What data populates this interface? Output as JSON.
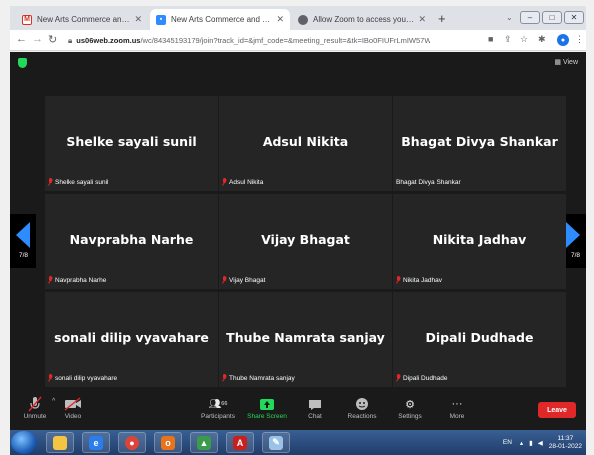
{
  "browser": {
    "tabs": [
      {
        "title": "New Arts Commerce and Scienc",
        "favicon": "gmail-icon",
        "active": false
      },
      {
        "title": "New Arts Commerce and Scienc",
        "favicon": "zoom-icon",
        "active": true
      },
      {
        "title": "Allow Zoom to access your came",
        "favicon": "chrome-icon",
        "active": false
      }
    ],
    "new_tab": "+",
    "url_host": "us06web.zoom.us",
    "url_path": "/wc/84345193179/join?track_id=&jmf_code=&meeting_result=&tk=IBo0FIUFrLmIW57W..."
  },
  "meeting": {
    "view_label": "View",
    "page_indicator": "7/8",
    "participants": [
      {
        "display": "Shelke sayali sunil",
        "label": "Shelke sayali sunil",
        "muted": true
      },
      {
        "display": "Adsul Nikita",
        "label": "Adsul Nikita",
        "muted": true
      },
      {
        "display": "Bhagat Divya Shankar",
        "label": "Bhagat Divya Shankar",
        "muted": false
      },
      {
        "display": "Navprabha Narhe",
        "label": "Navprabha Narhe",
        "muted": true
      },
      {
        "display": "Vijay Bhagat",
        "label": "Vijay Bhagat",
        "muted": true
      },
      {
        "display": "Nikita Jadhav",
        "label": "Nikita Jadhav",
        "muted": true
      },
      {
        "display": "sonali dilip vyavahare",
        "label": "sonali dilip vyavahare",
        "muted": true
      },
      {
        "display": "Thube Namrata sanjay",
        "label": "Thube Namrata sanjay",
        "muted": true
      },
      {
        "display": "Dipali Dudhade",
        "label": "Dipali Dudhade",
        "muted": true
      }
    ]
  },
  "toolbar": {
    "unmute": "Unmute",
    "video": "Video",
    "participants": "Participants",
    "participants_count": "66",
    "share": "Share Screen",
    "chat": "Chat",
    "reactions": "Reactions",
    "settings": "Settings",
    "more": "More",
    "leave": "Leave"
  },
  "taskbar": {
    "lang": "EN",
    "time": "11:37",
    "date": "28-01-2022"
  },
  "colors": {
    "zoom_bg": "#1a1a1a",
    "tile_bg": "#252525",
    "accent_blue": "#2d8cff",
    "leave_red": "#e02828",
    "share_green": "#23d959"
  }
}
